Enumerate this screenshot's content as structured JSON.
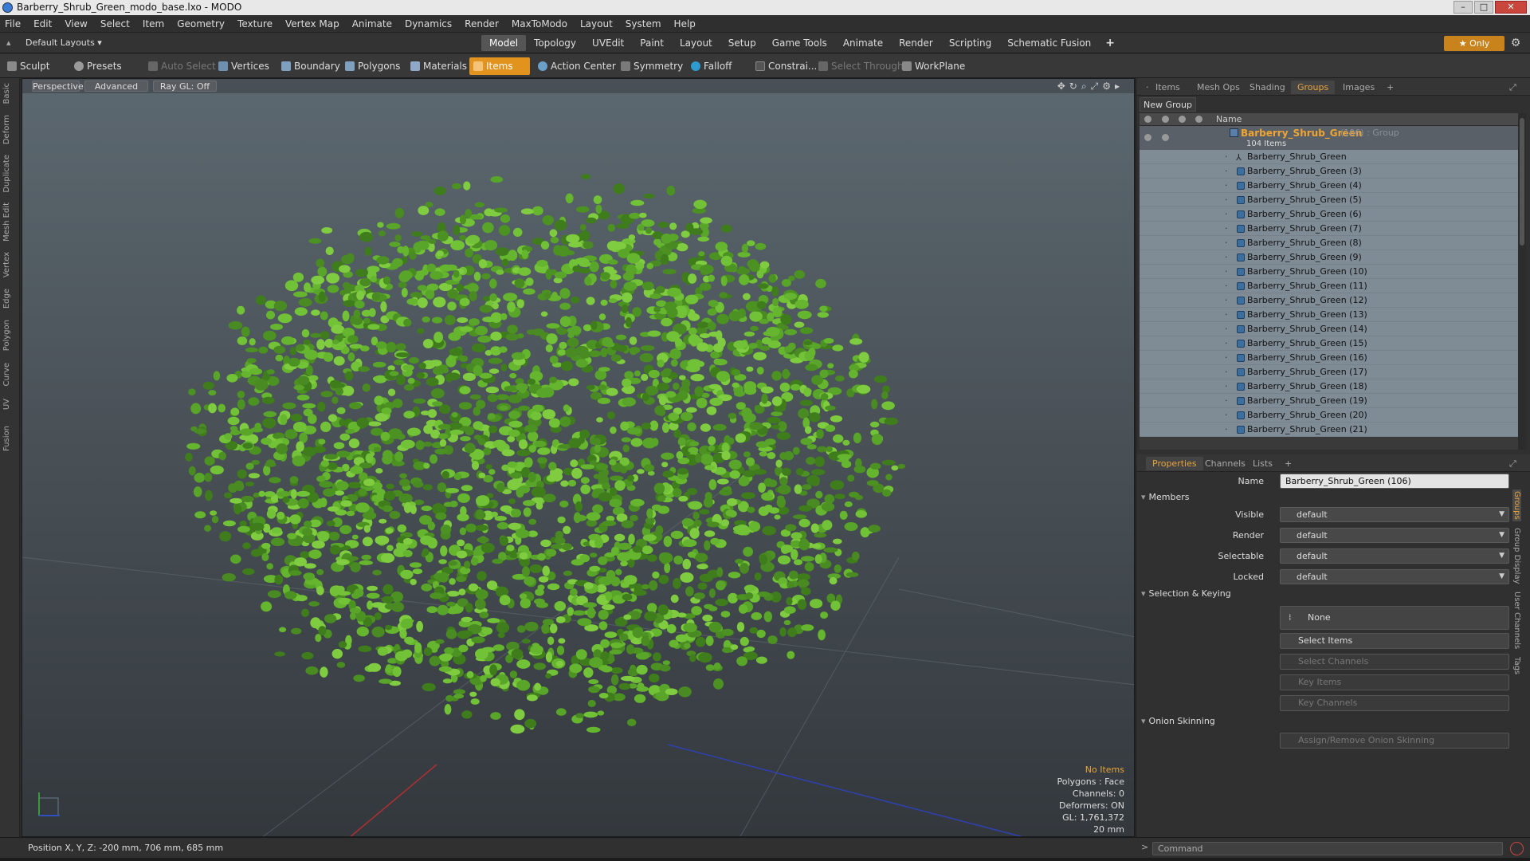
{
  "window": {
    "title": "Barberry_Shrub_Green_modo_base.lxo - MODO"
  },
  "menu": [
    "File",
    "Edit",
    "View",
    "Select",
    "Item",
    "Geometry",
    "Texture",
    "Vertex Map",
    "Animate",
    "Dynamics",
    "Render",
    "MaxToModo",
    "Layout",
    "System",
    "Help"
  ],
  "layout": {
    "selector": "Default Layouts ▾"
  },
  "mode_tabs": [
    "Model",
    "Topology",
    "UVEdit",
    "Paint",
    "Layout",
    "Setup",
    "Game Tools",
    "Animate",
    "Render",
    "Scripting",
    "Schematic Fusion"
  ],
  "mode_active": "Model",
  "only_button": "★  Only",
  "toolbar": {
    "sculpt": "Sculpt",
    "presets": "Presets",
    "auto_select": "Auto Select",
    "vertices": "Vertices",
    "boundary": "Boundary",
    "polygons": "Polygons",
    "materials": "Materials",
    "items": "Items",
    "action_center": "Action Center",
    "symmetry": "Symmetry",
    "falloff": "Falloff",
    "constraints": "Constrai...",
    "select_through": "Select Through",
    "workplane": "WorkPlane"
  },
  "left_tabs": [
    "Basic",
    "Deform",
    "Duplicate",
    "Mesh Edit",
    "Vertex",
    "Edge",
    "Polygon",
    "Curve",
    "UV",
    "Fusion"
  ],
  "viewport": {
    "perspective": "Perspective",
    "advanced": "Advanced",
    "raygl": "Ray GL: Off",
    "stats": {
      "title": "No Items",
      "polygons": "Polygons : Face",
      "channels": "Channels: 0",
      "deformers": "Deformers: ON",
      "gl": "GL: 1,761,372",
      "scale": "20 mm"
    }
  },
  "status": {
    "position": "Position X, Y, Z:  -200 mm, 706 mm, 685 mm"
  },
  "outliner": {
    "tabs": [
      "Items",
      "Mesh Ops",
      "Shading",
      "Groups",
      "Images"
    ],
    "active_tab": "Groups",
    "new_group": "New Group",
    "column_name": "Name",
    "group": {
      "name": "Barberry_Shrub_Green",
      "suffix": "(106) : Group",
      "count": "104 Items"
    },
    "items": [
      "Barberry_Shrub_Green",
      "Barberry_Shrub_Green (3)",
      "Barberry_Shrub_Green (4)",
      "Barberry_Shrub_Green (5)",
      "Barberry_Shrub_Green (6)",
      "Barberry_Shrub_Green (7)",
      "Barberry_Shrub_Green (8)",
      "Barberry_Shrub_Green (9)",
      "Barberry_Shrub_Green (10)",
      "Barberry_Shrub_Green (11)",
      "Barberry_Shrub_Green (12)",
      "Barberry_Shrub_Green (13)",
      "Barberry_Shrub_Green (14)",
      "Barberry_Shrub_Green (15)",
      "Barberry_Shrub_Green (16)",
      "Barberry_Shrub_Green (17)",
      "Barberry_Shrub_Green (18)",
      "Barberry_Shrub_Green (19)",
      "Barberry_Shrub_Green (20)",
      "Barberry_Shrub_Green (21)"
    ]
  },
  "properties": {
    "tabs": [
      "Properties",
      "Channels",
      "Lists"
    ],
    "name_label": "Name",
    "name_value": "Barberry_Shrub_Green (106)",
    "members_section": "Members",
    "visible_label": "Visible",
    "visible_value": "default",
    "render_label": "Render",
    "render_value": "default",
    "selectable_label": "Selectable",
    "selectable_value": "default",
    "locked_label": "Locked",
    "locked_value": "default",
    "selection_section": "Selection & Keying",
    "none_button": "None",
    "select_items": "Select Items",
    "select_channels": "Select Channels",
    "key_items": "Key Items",
    "key_channels": "Key Channels",
    "onion_section": "Onion Skinning",
    "onion_button": "Assign/Remove Onion Skinning",
    "side_tabs": [
      "Groups",
      "Group Display",
      "User Channels",
      "Tags"
    ]
  },
  "command": {
    "placeholder": "Command"
  },
  "colors": {
    "accent": "#e2931e",
    "group_name": "#f0a432",
    "foliage": "#5aa82a"
  }
}
